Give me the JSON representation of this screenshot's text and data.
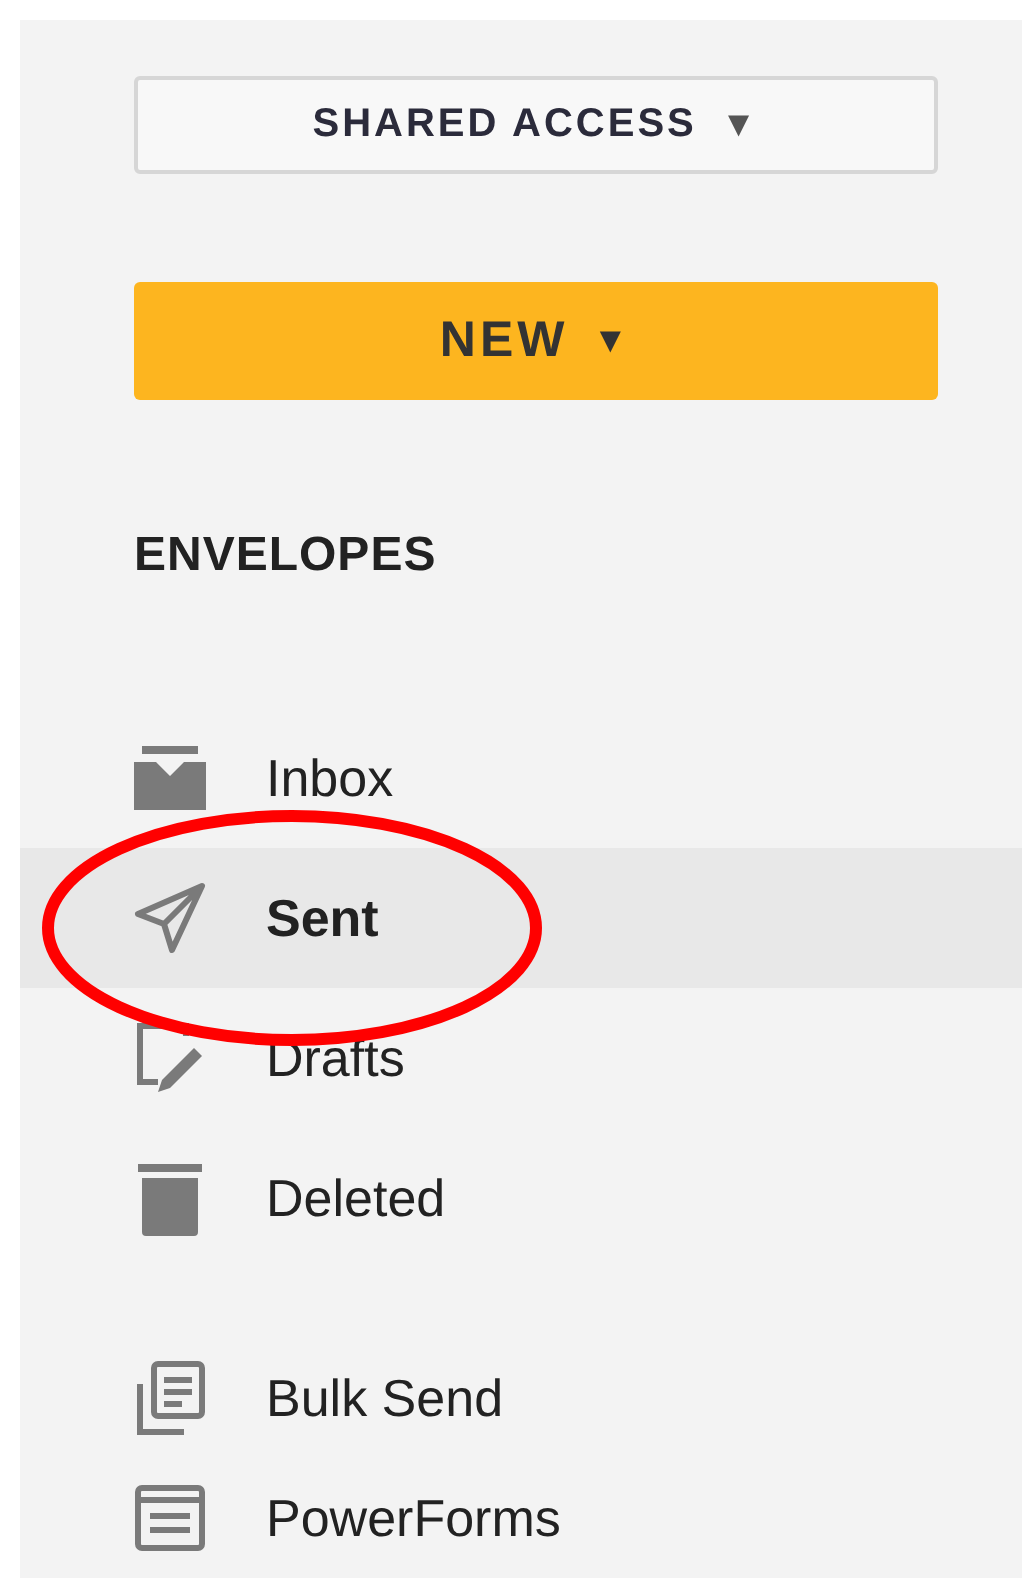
{
  "shared_access_button": {
    "label": "SHARED ACCESS",
    "caret": "▼"
  },
  "new_button": {
    "label": "NEW",
    "caret": "▼"
  },
  "section_title": "ENVELOPES",
  "folders": [
    {
      "label": "Inbox",
      "kind": "inbox",
      "selected": false
    },
    {
      "label": "Sent",
      "kind": "sent",
      "selected": true
    },
    {
      "label": "Drafts",
      "kind": "drafts",
      "selected": false
    },
    {
      "label": "Deleted",
      "kind": "deleted",
      "selected": false
    }
  ],
  "tools": [
    {
      "label": "Bulk Send",
      "kind": "bulk"
    },
    {
      "label": "PowerForms",
      "kind": "forms"
    }
  ],
  "annotation": {
    "kind": "ellipse",
    "color": "#ff0000"
  }
}
